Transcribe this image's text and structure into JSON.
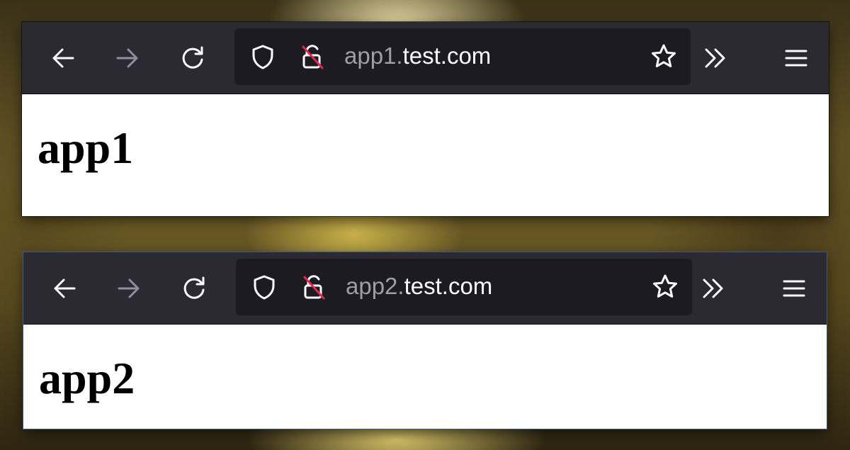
{
  "windows": [
    {
      "url_subdomain": "app1.",
      "url_host": "test.com",
      "heading": "app1"
    },
    {
      "url_subdomain": "app2.",
      "url_host": "test.com",
      "heading": "app2"
    }
  ],
  "icons": {
    "back": "arrow-left-icon",
    "forward": "arrow-right-icon",
    "reload": "reload-icon",
    "tracking_protection": "shield-icon",
    "connection": "insecure-lock-icon",
    "bookmark": "star-icon",
    "overflow": "double-chevron-right-icon",
    "menu": "hamburger-menu-icon"
  },
  "colors": {
    "toolbar_bg": "#2b2a33",
    "urlbar_bg": "#1c1b22",
    "icon": "#fbfbfe",
    "icon_disabled": "#8f8f9d",
    "insecure_strike": "#e22850",
    "url_subdomain": "#9f9ea6",
    "url_host": "#fbfbfe"
  }
}
